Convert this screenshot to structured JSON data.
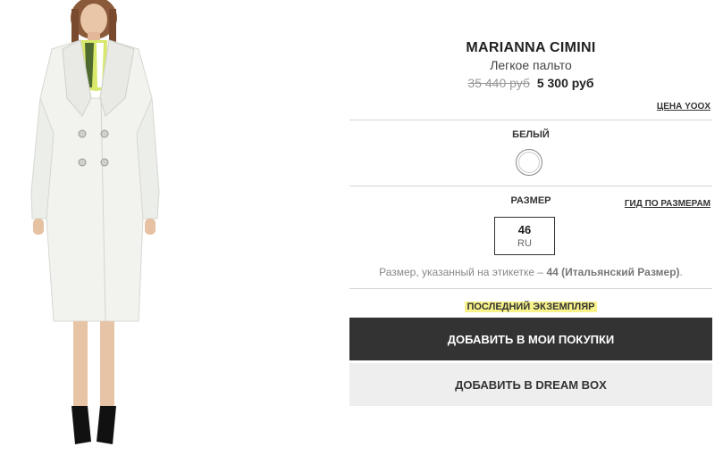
{
  "product": {
    "brand": "MARIANNA CIMINI",
    "title": "Легкое пальто",
    "old_price": "35 440 руб",
    "new_price": "5 300 руб",
    "yoox_price_link": "ЦЕНА YOOX"
  },
  "color": {
    "label": "БЕЛЫЙ",
    "swatch_color": "#ffffff"
  },
  "size": {
    "label": "РАЗМЕР",
    "guide_link": "ГИД ПО РАЗМЕРАМ",
    "selected_value": "46",
    "selected_unit": "RU",
    "note_prefix": "Размер, указанный на этикетке –",
    "note_value": "44 (Итальянский Размер)",
    "note_suffix": "."
  },
  "stock": {
    "badge": "ПОСЛЕДНИЙ ЭКЗЕМПЛЯР"
  },
  "actions": {
    "add_to_cart": "ДОБАВИТЬ В МОИ ПОКУПКИ",
    "add_to_dreambox": "ДОБАВИТЬ В DREAM BOX"
  },
  "colors": {
    "buy_button_bg": "#333333",
    "dream_button_bg": "#eeeeee",
    "highlight": "#f7f28a"
  }
}
